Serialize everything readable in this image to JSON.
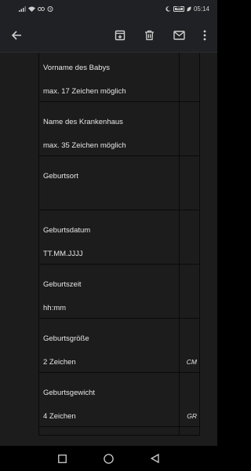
{
  "status_bar": {
    "time": "05:14",
    "battery_level": "81",
    "left_icons": [
      "signal-icon",
      "wifi-icon",
      "owl-icon",
      "alarm-icon"
    ],
    "right_icons": [
      "moon-icon",
      "battery-icon",
      "leaf-icon"
    ]
  },
  "toolbar": {
    "icons": [
      "back-arrow-icon",
      "archive-icon",
      "delete-icon",
      "mail-icon",
      "more-vert-icon"
    ]
  },
  "rows": [
    {
      "label": "Vorname des Babys",
      "hint": "max. 17 Zeichen möglich",
      "unit": ""
    },
    {
      "label": "Name des Krankenhaus",
      "hint": "max. 35 Zeichen möglich",
      "unit": ""
    },
    {
      "label": "Geburtsort",
      "hint": "",
      "unit": ""
    },
    {
      "label": "Geburtsdatum",
      "hint": "TT.MM.JJJJ",
      "unit": ""
    },
    {
      "label": "Geburtszeit",
      "hint": "hh:mm",
      "unit": ""
    },
    {
      "label": "Geburtsgröße",
      "hint": "2 Zeichen",
      "unit": "CM"
    },
    {
      "label": "Geburtsgewicht",
      "hint": "4 Zeichen",
      "unit": "GR"
    }
  ],
  "colors": {
    "background": "#1c1c1c",
    "toolbar": "#202124",
    "text": "#e6e6e6"
  }
}
